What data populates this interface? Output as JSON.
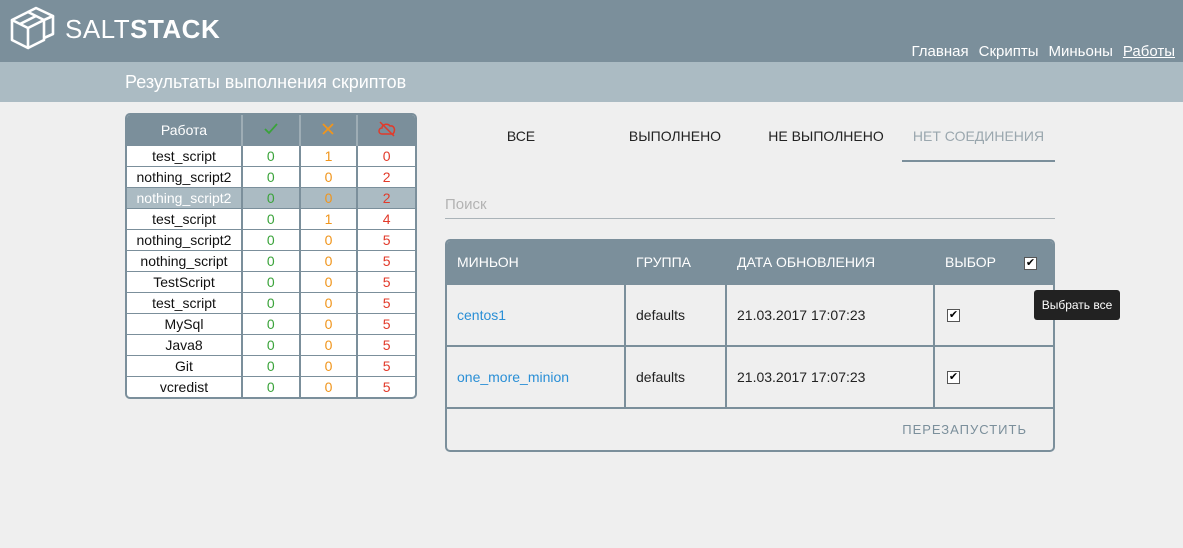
{
  "brand": {
    "light": "SALT",
    "bold": "STACK"
  },
  "nav": {
    "items": [
      {
        "label": "Главная"
      },
      {
        "label": "Скрипты"
      },
      {
        "label": "Миньоны"
      },
      {
        "label": "Работы",
        "active": true
      }
    ]
  },
  "page_title": "Результаты выполнения скриптов",
  "jobs_table": {
    "headers": {
      "name": "Работа",
      "ok_icon": "check-icon",
      "warn_icon": "cross-icon",
      "err_icon": "cloud-off-icon"
    },
    "rows": [
      {
        "name": "test_script",
        "ok": "0",
        "warn": "1",
        "err": "0"
      },
      {
        "name": "nothing_script2",
        "ok": "0",
        "warn": "0",
        "err": "2"
      },
      {
        "name": "nothing_script2",
        "ok": "0",
        "warn": "0",
        "err": "2",
        "selected": true
      },
      {
        "name": "test_script",
        "ok": "0",
        "warn": "1",
        "err": "4"
      },
      {
        "name": "nothing_script2",
        "ok": "0",
        "warn": "0",
        "err": "5"
      },
      {
        "name": "nothing_script",
        "ok": "0",
        "warn": "0",
        "err": "5"
      },
      {
        "name": "TestScript",
        "ok": "0",
        "warn": "0",
        "err": "5"
      },
      {
        "name": "test_script",
        "ok": "0",
        "warn": "0",
        "err": "5"
      },
      {
        "name": "MySql",
        "ok": "0",
        "warn": "0",
        "err": "5"
      },
      {
        "name": "Java8",
        "ok": "0",
        "warn": "0",
        "err": "5"
      },
      {
        "name": "Git",
        "ok": "0",
        "warn": "0",
        "err": "5"
      },
      {
        "name": "vcredist",
        "ok": "0",
        "warn": "0",
        "err": "5"
      }
    ]
  },
  "tabs": [
    {
      "label": "ВСЕ"
    },
    {
      "label": "ВЫПОЛНЕНО"
    },
    {
      "label": "НЕ ВЫПОЛНЕНО"
    },
    {
      "label": "НЕТ СОЕДИНЕНИЯ",
      "active": true
    }
  ],
  "search": {
    "placeholder": "Поиск",
    "value": ""
  },
  "minions_table": {
    "headers": {
      "minion": "МИНЬОН",
      "group": "ГРУППА",
      "date": "ДАТА ОБНОВЛЕНИЯ",
      "select": "ВЫБОР"
    },
    "rows": [
      {
        "minion": "centos1",
        "group": "defaults",
        "date": "21.03.2017 17:07:23",
        "checked": true
      },
      {
        "minion": "one_more_minion",
        "group": "defaults",
        "date": "21.03.2017 17:07:23",
        "checked": true
      }
    ],
    "restart_label": "ПЕРЕЗАПУСТИТЬ"
  },
  "tooltip": "Выбрать все",
  "colors": {
    "header_bg": "#7b8f9b",
    "subheader_bg": "#abbbc3",
    "ok": "#3aa33a",
    "warn": "#f0951c",
    "error": "#e23a2a",
    "link": "#2a8fd6"
  }
}
